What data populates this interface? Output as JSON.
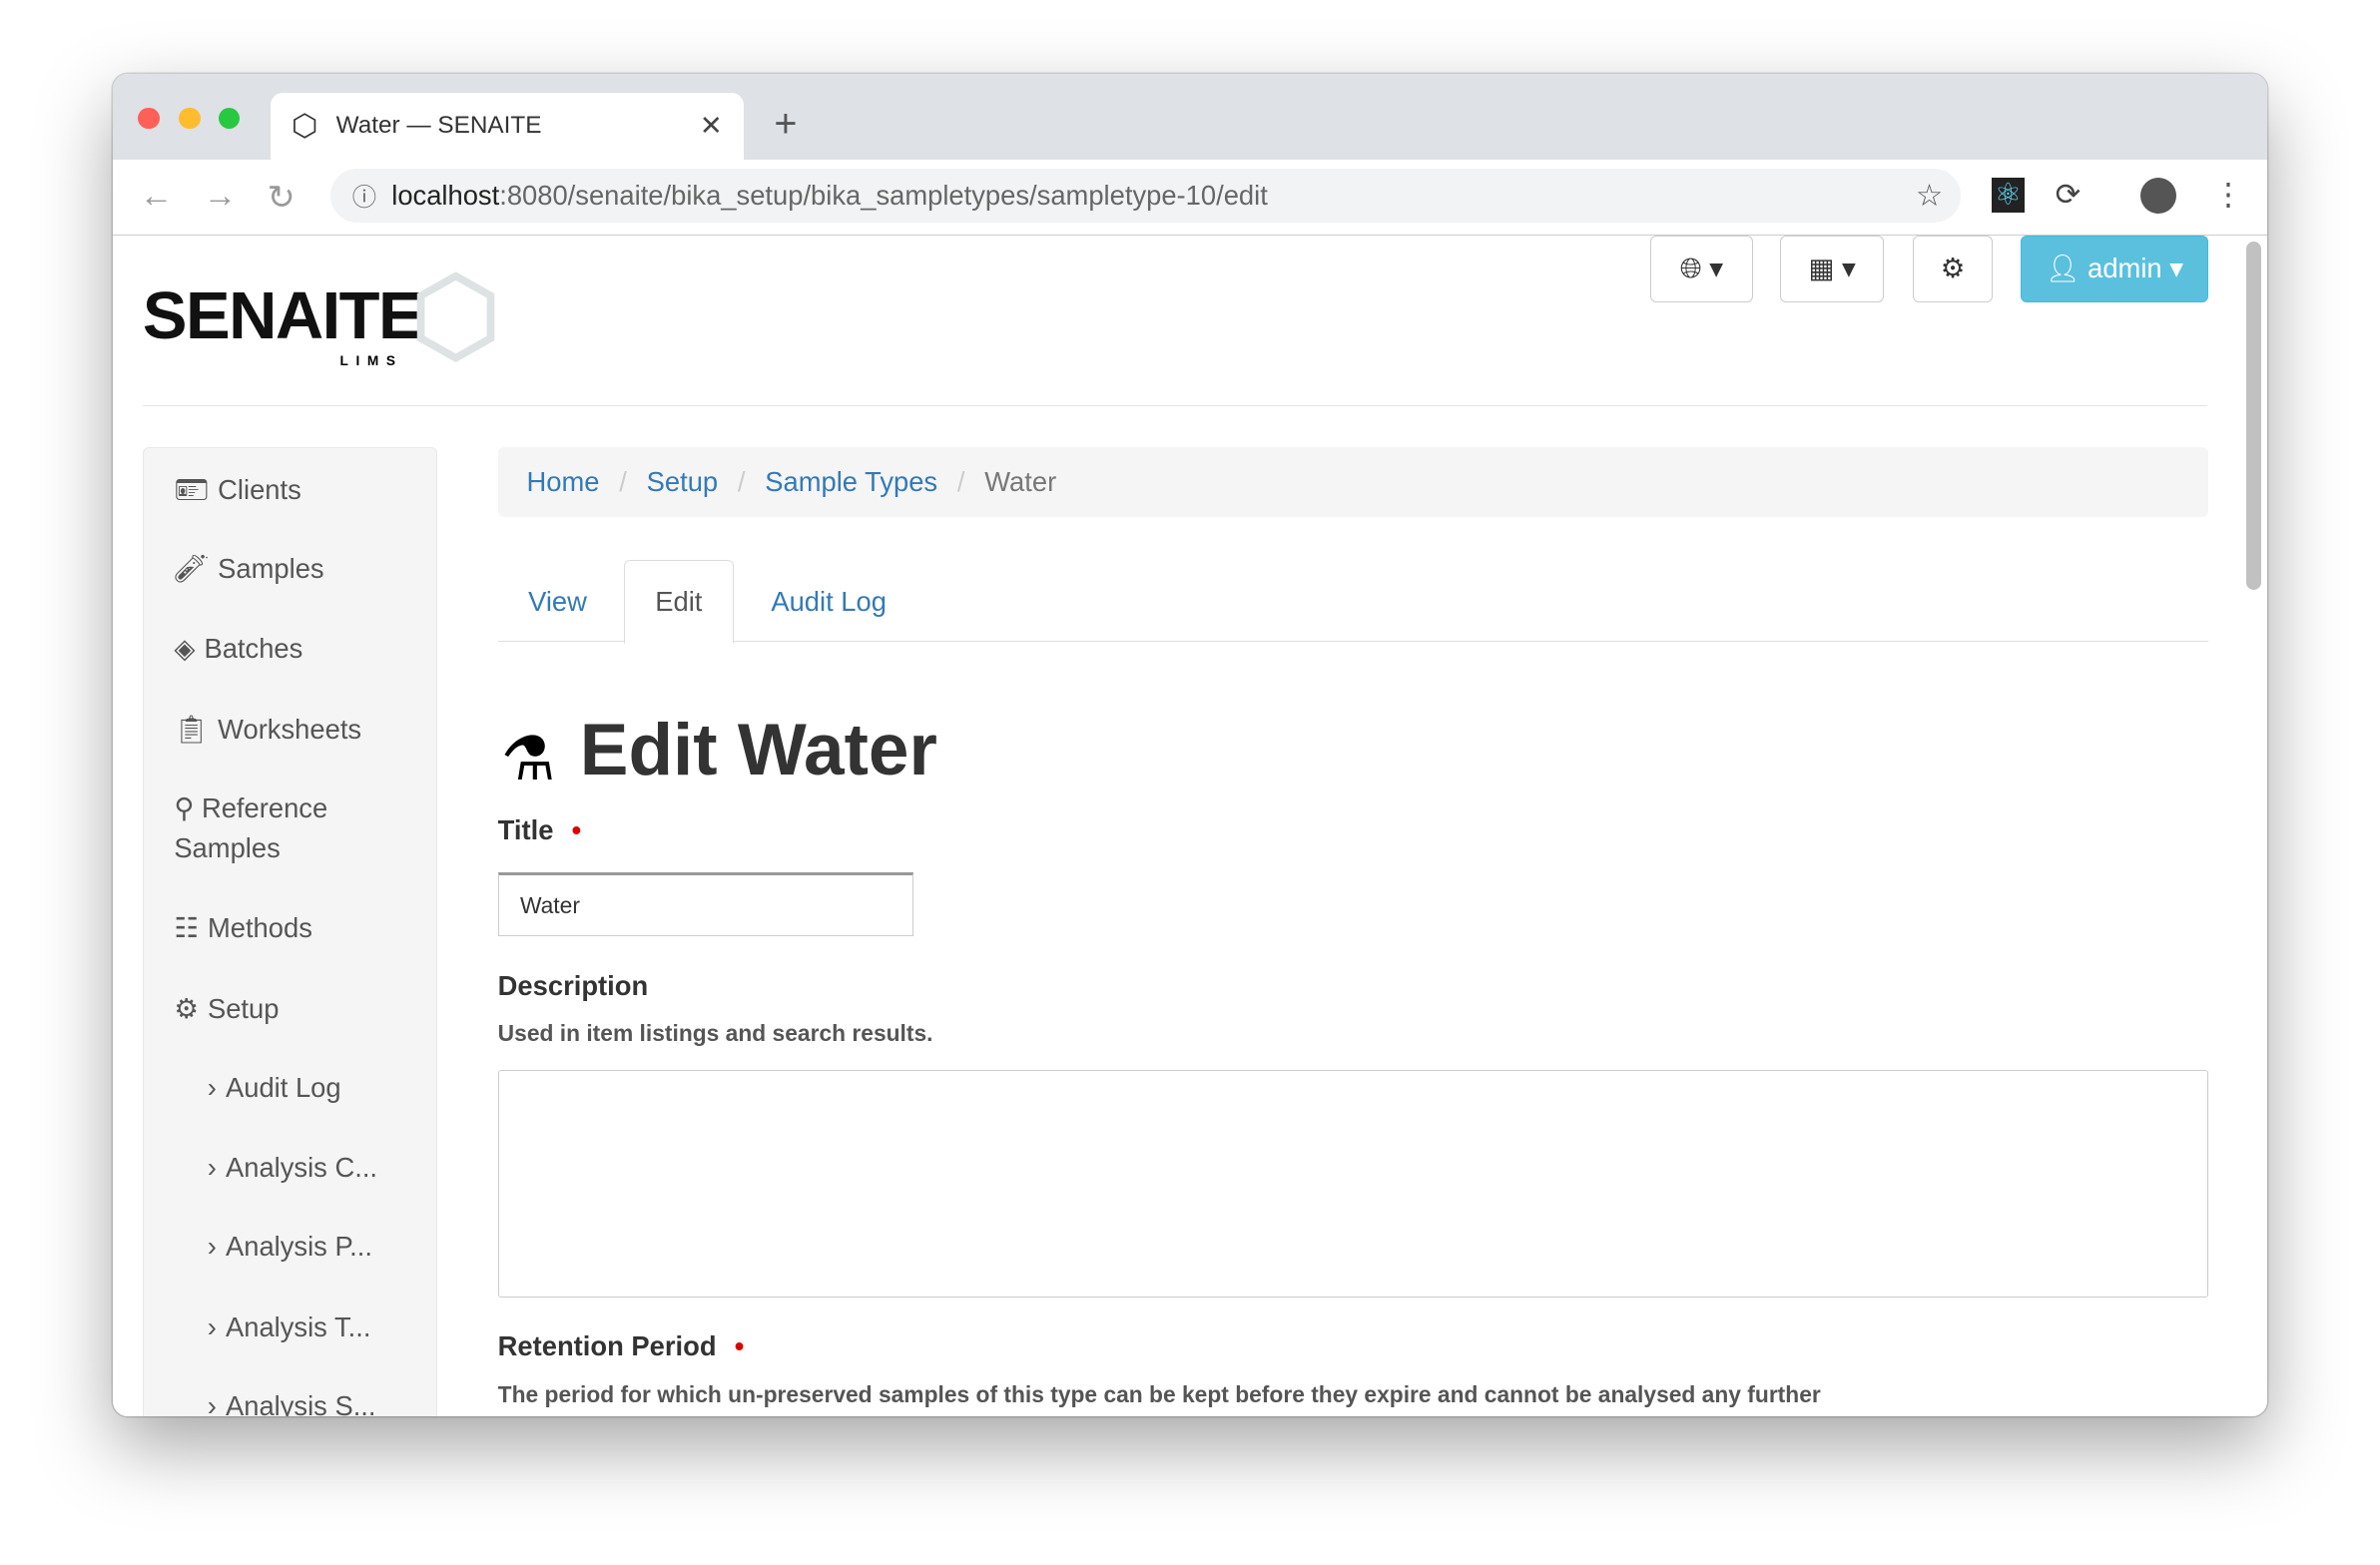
{
  "browser": {
    "tab_title": "Water — SENAITE",
    "url_host": "localhost",
    "url_path": ":8080/senaite/bika_setup/bika_sampletypes/sampletype-10/edit",
    "colors": {
      "close": "#fe5f57",
      "min": "#febc2e",
      "max": "#28c840"
    }
  },
  "header": {
    "logo": "SENAITE",
    "logo_sub": "LIMS",
    "user": "admin",
    "accent": "#5bc0de"
  },
  "sidebar": {
    "items": [
      {
        "label": "Clients",
        "icon": "id-card-icon"
      },
      {
        "label": "Samples",
        "icon": "test-tube-icon"
      },
      {
        "label": "Batches",
        "icon": "layers-icon"
      },
      {
        "label": "Worksheets",
        "icon": "clipboard-icon"
      },
      {
        "label": "Reference Samples",
        "icon": "reference-icon"
      },
      {
        "label": "Methods",
        "icon": "list-icon"
      },
      {
        "label": "Setup",
        "icon": "gears-icon"
      }
    ],
    "sub_items": [
      "Audit Log",
      "Analysis C...",
      "Analysis P...",
      "Analysis T...",
      "Analysis S..."
    ]
  },
  "breadcrumb": [
    "Home",
    "Setup",
    "Sample Types",
    "Water"
  ],
  "tabs": [
    "View",
    "Edit",
    "Audit Log"
  ],
  "main": {
    "heading": "Edit Water",
    "title_label": "Title",
    "title_value": "Water",
    "description_label": "Description",
    "description_help": "Used in item listings and search results.",
    "description_value": "",
    "retention_label": "Retention Period",
    "retention_help": "The period for which un-preserved samples of this type can be kept before they expire and cannot be analysed any further"
  }
}
